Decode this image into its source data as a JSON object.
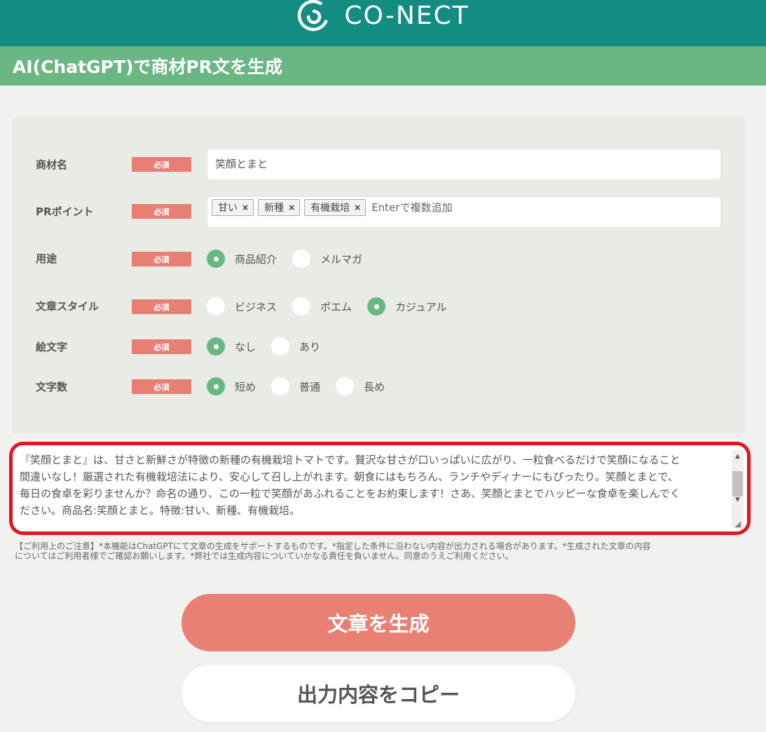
{
  "header": {
    "logo_text": "CO-NECT",
    "logo_icon": "conect-logo-icon",
    "brand_color": "#138d82"
  },
  "title_bar": {
    "title": "AI(ChatGPT)で商材PR文を生成",
    "color": "#6ab783"
  },
  "form": {
    "required_label": "必須",
    "product_name": {
      "label": "商材名",
      "value": "笑顔とまと"
    },
    "pr_points": {
      "label": "PRポイント",
      "tags": [
        "甘い",
        "新種",
        "有機栽培"
      ],
      "remove_icon": "×",
      "placeholder": "Enterで複数追加"
    },
    "usage": {
      "label": "用途",
      "options": [
        "商品紹介",
        "メルマガ"
      ],
      "selected": "商品紹介"
    },
    "style": {
      "label": "文章スタイル",
      "options": [
        "ビジネス",
        "ポエム",
        "カジュアル"
      ],
      "selected": "カジュアル"
    },
    "emoji": {
      "label": "絵文字",
      "options": [
        "なし",
        "あり"
      ],
      "selected": "なし"
    },
    "length": {
      "label": "文字数",
      "options": [
        "短め",
        "普通",
        "長め"
      ],
      "selected": "短め"
    }
  },
  "output": {
    "lines": [
      "『笑顔とまと』は、甘さと新鮮さが特徴の新種の有機栽培トマトです。贅沢な甘さが口いっぱいに広がり、一粒食べるだけで笑顔になること",
      "間違いなし！厳選された有機栽培法により、安心して召し上がれます。朝食にはもちろん、ランチやディナーにもぴったり。笑顔とまとで、",
      "毎日の食卓を彩りませんか？命名の通り、この一粒で笑顔があふれることをお約束します！さあ、笑顔とまとでハッピーな食卓を楽しんでく",
      "ださい。商品名:笑顔とまと。特徴:甘い、新種、有機栽培。"
    ],
    "highlight_color": "#e4141e"
  },
  "notice": {
    "line1": "【ご利用上のご注意】*本機能はChatGPTにて文章の生成をサポートするものです。*指定した条件に沿わない内容が出力される場合があります。*生成された文章の内容",
    "line2": "についてはご利用者様でご確認お願いします。*弊社では生成内容についていかなる責任を負いません。同意のうえご利用ください。"
  },
  "buttons": {
    "generate": "文章を生成",
    "copy": "出力内容をコピー"
  }
}
